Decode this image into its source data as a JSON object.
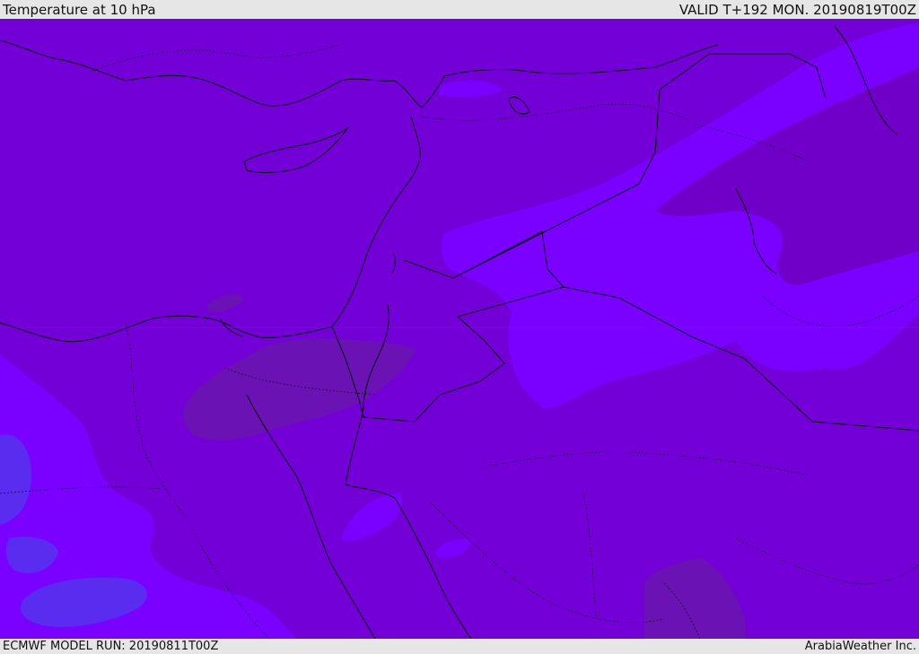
{
  "header": {
    "title": "Temperature at 10 hPa",
    "valid": "VALID T+192 MON. 20190819T00Z"
  },
  "footer": {
    "model_run": "ECMWF MODEL RUN: 20190811T00Z",
    "credit": "ArabiaWeather Inc."
  },
  "colors": {
    "base": "#7300d6",
    "warm": "#6a12b4",
    "cool": "#7a00ff",
    "colder": "#5a2cf0",
    "border": "#000000"
  }
}
